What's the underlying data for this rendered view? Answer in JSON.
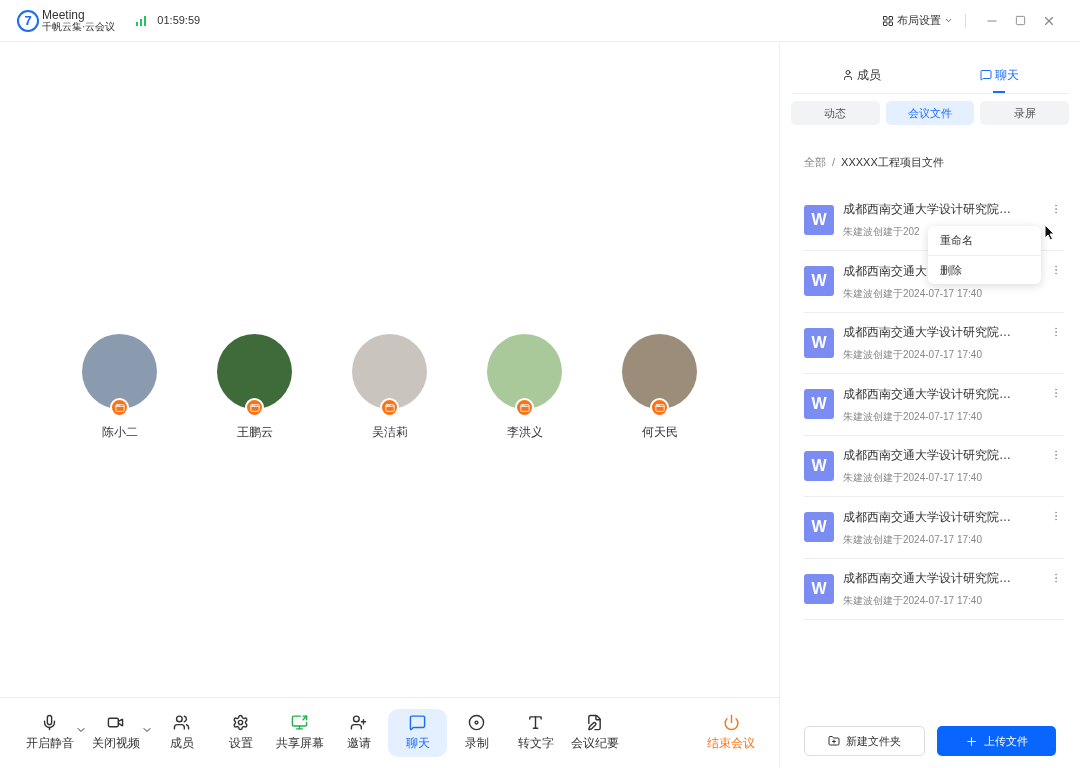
{
  "app": {
    "logo_mark": "7",
    "name": "Meeting",
    "tagline": "千帆云集·云会议",
    "timer": "01:59:59"
  },
  "window_controls": {
    "layout_label": "布局设置"
  },
  "participants": [
    {
      "name": "陈小二"
    },
    {
      "name": "王鹏云"
    },
    {
      "name": "吴洁莉"
    },
    {
      "name": "李洪义"
    },
    {
      "name": "何天民"
    }
  ],
  "toolbar": [
    {
      "label": "开启静音",
      "has_menu": true,
      "selected": false,
      "kind": "normal"
    },
    {
      "label": "关闭视频",
      "has_menu": true,
      "selected": false,
      "kind": "normal"
    },
    {
      "label": "成员",
      "has_menu": false,
      "selected": false,
      "kind": "normal"
    },
    {
      "label": "设置",
      "has_menu": false,
      "selected": false,
      "kind": "normal"
    },
    {
      "label": "共享屏幕",
      "has_menu": false,
      "selected": false,
      "kind": "share"
    },
    {
      "label": "邀请",
      "has_menu": false,
      "selected": false,
      "kind": "normal"
    },
    {
      "label": "聊天",
      "has_menu": false,
      "selected": true,
      "kind": "normal"
    },
    {
      "label": "录制",
      "has_menu": false,
      "selected": false,
      "kind": "normal"
    },
    {
      "label": "转文字",
      "has_menu": false,
      "selected": false,
      "kind": "normal"
    },
    {
      "label": "会议纪要",
      "has_menu": false,
      "selected": false,
      "kind": "normal"
    }
  ],
  "end_button": {
    "label": "结束会议"
  },
  "side_panel": {
    "tabs": [
      {
        "label": "成员",
        "selected": false
      },
      {
        "label": "聊天",
        "selected": true
      }
    ],
    "subtabs": [
      {
        "label": "动态",
        "selected": false
      },
      {
        "label": "会议文件",
        "selected": true
      },
      {
        "label": "录屏",
        "selected": false
      }
    ],
    "breadcrumb": {
      "items": [
        "全部",
        "XXXXX工程项目文件"
      ],
      "separator": "/"
    },
    "files": [
      {
        "icon_letter": "W",
        "title": "成都西南交通大学设计研究院…",
        "subtitle": "朱建波创建于202"
      },
      {
        "icon_letter": "W",
        "title": "成都西南交通大",
        "subtitle": "朱建波创建于2024-07-17 17:40"
      },
      {
        "icon_letter": "W",
        "title": "成都西南交通大学设计研究院…",
        "subtitle": "朱建波创建于2024-07-17 17:40"
      },
      {
        "icon_letter": "W",
        "title": "成都西南交通大学设计研究院…",
        "subtitle": "朱建波创建于2024-07-17 17:40"
      },
      {
        "icon_letter": "W",
        "title": "成都西南交通大学设计研究院…",
        "subtitle": "朱建波创建于2024-07-17 17:40"
      },
      {
        "icon_letter": "W",
        "title": "成都西南交通大学设计研究院…",
        "subtitle": "朱建波创建于2024-07-17 17:40"
      },
      {
        "icon_letter": "W",
        "title": "成都西南交通大学设计研究院…",
        "subtitle": "朱建波创建于2024-07-17 17:40"
      }
    ],
    "context_menu": [
      "重命名",
      "删除"
    ],
    "buttons": [
      {
        "label": "新建文件夹",
        "kind": "secondary"
      },
      {
        "label": "上传文件",
        "kind": "primary"
      }
    ]
  }
}
